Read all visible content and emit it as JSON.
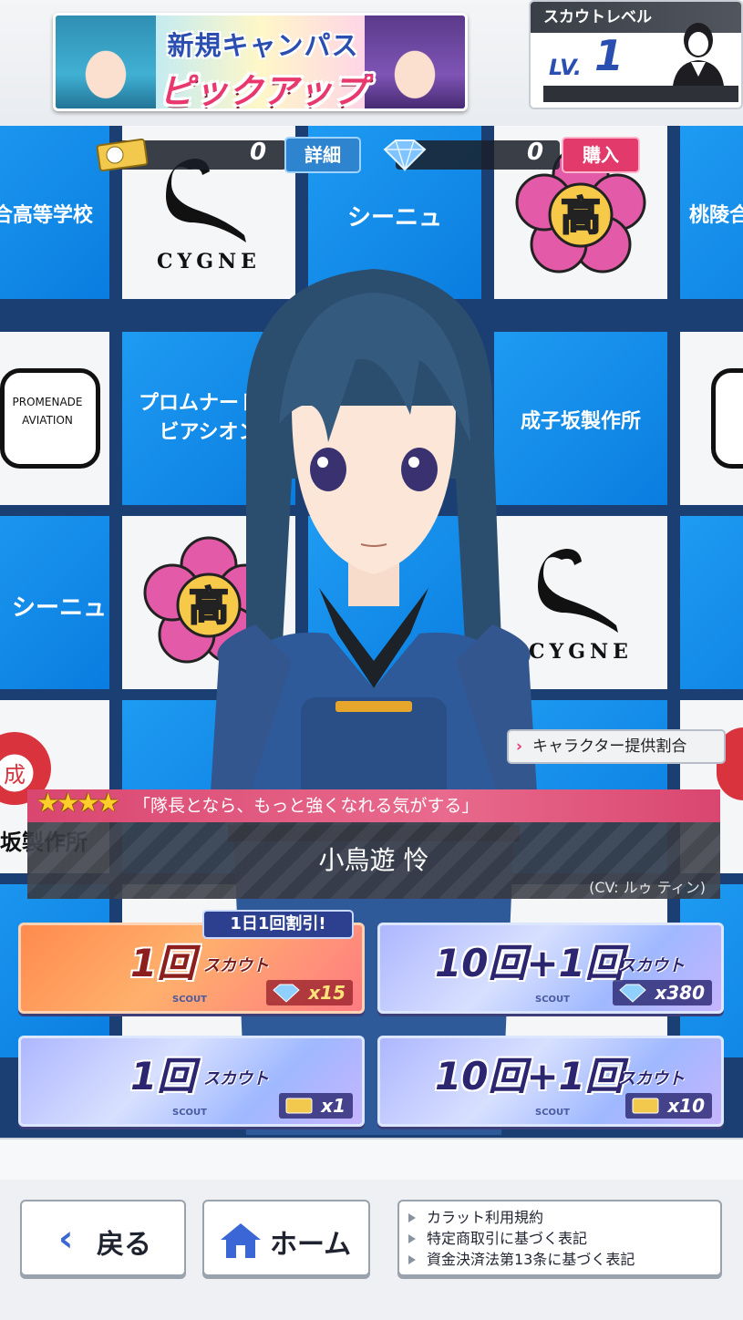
{
  "banner": {
    "line1": "新規キャンパス",
    "line2": "ピックアップ"
  },
  "scout_level": {
    "title": "スカウトレベル",
    "lv_label": "LV.",
    "level": "1"
  },
  "currency": {
    "ticket_count": "0",
    "detail_label": "詳細",
    "gem_count": "0",
    "buy_label": "購入"
  },
  "background_tiles": {
    "school_name": "桃陵合高等学校",
    "cygne_jp": "シーニュ",
    "cygne_en": "CYGNE",
    "promenade_jp": "プロムナードアビアシオン",
    "promenade_en_1": "PROMENADE",
    "promenade_en_2": "AVIATION",
    "naruko_jp": "成子坂製作所",
    "kou_char": "高",
    "sei_char": "成"
  },
  "rate_link": "キャラクター提供割合",
  "character": {
    "rarity_stars": 4,
    "stars_text": "★★★★",
    "quote": "「隊長となら、もっと強くなれる気がする」",
    "name": "小鳥遊 怜",
    "cv": "(CV: ルゥ ティン)"
  },
  "scout_buttons": [
    {
      "main": "1回",
      "sub": "スカウト",
      "tag": "SCOUT",
      "cost": "x15",
      "cost_icon": "gem-icon",
      "style": "orange"
    },
    {
      "main": "10回+1回",
      "sub": "スカウト",
      "tag": "SCOUT",
      "cost": "x380",
      "cost_icon": "gem-icon",
      "style": "purple"
    },
    {
      "main": "1回",
      "sub": "スカウト",
      "tag": "SCOUT",
      "cost": "x1",
      "cost_icon": "ticket-icon",
      "style": "purple"
    },
    {
      "main": "10回+1回",
      "sub": "スカウト",
      "tag": "SCOUT",
      "cost": "x10",
      "cost_icon": "ticket-icon",
      "style": "purple"
    }
  ],
  "discount_tag": "1日1回割引!",
  "footer": {
    "back_label": "戻る",
    "home_label": "ホーム",
    "legal": [
      "カラット利用規約",
      "特定商取引に基づく表記",
      "資金決済法第13条に基づく表記"
    ]
  },
  "colors": {
    "tile_blue": "#1e9bf2",
    "accent_pink": "#e23a6b",
    "navy": "#2c2670"
  }
}
